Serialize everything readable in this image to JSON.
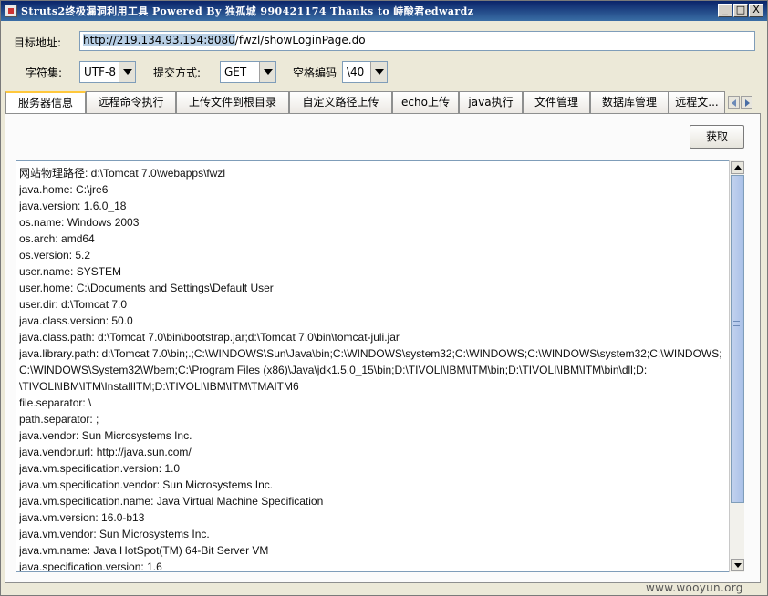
{
  "window": {
    "title": "Struts2终极漏洞利用工具   Powered By 独孤城 990421174 Thanks to 峙酸君edwardz",
    "minimize": "_",
    "maximize": "□",
    "close": "X"
  },
  "form": {
    "url_label": "目标地址:",
    "url_selected": "http://219.134.93.154:8080",
    "url_rest": "/fwzl/showLoginPage.do",
    "charset_label": "字符集:",
    "charset_value": "UTF-8",
    "method_label": "提交方式:",
    "method_value": "GET",
    "space_label": "空格编码",
    "space_value": "\\40"
  },
  "tabs": [
    {
      "label": "服务器信息",
      "active": true
    },
    {
      "label": "远程命令执行"
    },
    {
      "label": "上传文件到根目录"
    },
    {
      "label": "自定义路径上传"
    },
    {
      "label": "echo上传"
    },
    {
      "label": "java执行"
    },
    {
      "label": "文件管理"
    },
    {
      "label": "数据库管理"
    },
    {
      "label": "远程文..."
    }
  ],
  "panel": {
    "fetch_button": "获取",
    "lines": [
      "网站物理路径:  d:\\Tomcat 7.0\\webapps\\fwzl",
      "java.home: C:\\jre6",
      "java.version: 1.6.0_18",
      "os.name: Windows 2003",
      "os.arch: amd64",
      "os.version: 5.2",
      "user.name: SYSTEM",
      "user.home: C:\\Documents and Settings\\Default User",
      "user.dir: d:\\Tomcat 7.0",
      "java.class.version: 50.0",
      "java.class.path: d:\\Tomcat 7.0\\bin\\bootstrap.jar;d:\\Tomcat 7.0\\bin\\tomcat-juli.jar",
      "java.library.path: d:\\Tomcat 7.0\\bin;.;C:\\WINDOWS\\Sun\\Java\\bin;C:\\WINDOWS\\system32;C:\\WINDOWS;C:\\WINDOWS\\system32;C:\\WINDOWS;",
      "C:\\WINDOWS\\System32\\Wbem;C:\\Program Files (x86)\\Java\\jdk1.5.0_15\\bin;D:\\TIVOLI\\IBM\\ITM\\bin;D:\\TIVOLI\\IBM\\ITM\\bin\\dll;D:",
      "\\TIVOLI\\IBM\\ITM\\InstallITM;D:\\TIVOLI\\IBM\\ITM\\TMAITM6",
      "file.separator: \\",
      "path.separator: ;",
      "java.vendor: Sun Microsystems Inc.",
      "java.vendor.url: http://java.sun.com/",
      "java.vm.specification.version: 1.0",
      "java.vm.specification.vendor: Sun Microsystems Inc.",
      "java.vm.specification.name: Java Virtual Machine Specification",
      "java.vm.version: 16.0-b13",
      "java.vm.vendor: Sun Microsystems Inc.",
      "java.vm.name: Java HotSpot(TM) 64-Bit Server VM",
      "java.specification.version: 1.6"
    ]
  },
  "watermark": "www.wooyun.org"
}
